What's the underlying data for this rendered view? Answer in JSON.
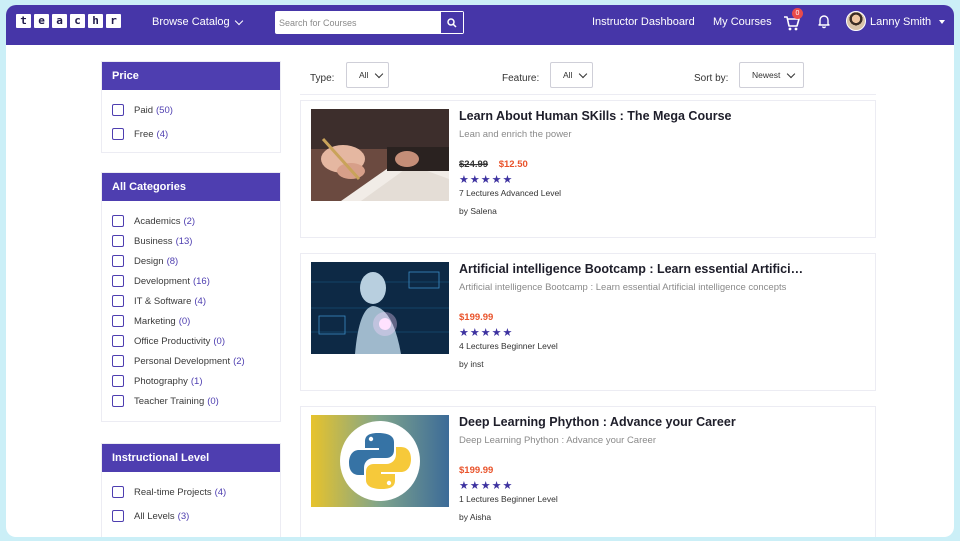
{
  "navbar": {
    "logo_letters": [
      "t",
      "e",
      "a",
      "c",
      "h",
      "r"
    ],
    "browse_label": "Browse Catalog",
    "search_placeholder": "Search for Courses",
    "instructor_dashboard": "Instructor Dashboard",
    "my_courses": "My Courses",
    "cart_count": "0",
    "user_name": "Lanny Smith",
    "accent_color": "#4636a8"
  },
  "sidebar": {
    "price": {
      "title": "Price",
      "items": [
        {
          "label": "Paid",
          "count": "(50)"
        },
        {
          "label": "Free",
          "count": "(4)"
        }
      ]
    },
    "categories": {
      "title": "All Categories",
      "items": [
        {
          "label": "Academics",
          "count": "(2)"
        },
        {
          "label": "Business",
          "count": "(13)"
        },
        {
          "label": "Design",
          "count": "(8)"
        },
        {
          "label": "Development",
          "count": "(16)"
        },
        {
          "label": "IT & Software",
          "count": "(4)"
        },
        {
          "label": "Marketing",
          "count": "(0)"
        },
        {
          "label": "Office Productivity",
          "count": "(0)"
        },
        {
          "label": "Personal Development",
          "count": "(2)"
        },
        {
          "label": "Photography",
          "count": "(1)"
        },
        {
          "label": "Teacher Training",
          "count": "(0)"
        }
      ]
    },
    "level": {
      "title": "Instructional Level",
      "items": [
        {
          "label": "Real-time Projects",
          "count": "(4)"
        },
        {
          "label": "All Levels",
          "count": "(3)"
        }
      ]
    }
  },
  "filters": {
    "type_label": "Type:",
    "type_value": "All",
    "feature_label": "Feature:",
    "feature_value": "All",
    "sort_label": "Sort by:",
    "sort_value": "Newest"
  },
  "courses": [
    {
      "title": "Learn About Human SKills : The Mega Course",
      "subtitle": "Lean and enrich the power",
      "old_price": "$24.99",
      "price": "$12.50",
      "stars": "★★★★★",
      "meta": "7 Lectures  Advanced Level",
      "by": "by Salena"
    },
    {
      "title": "Artificial intelligence Bootcamp : Learn essential Artificial...",
      "subtitle": "Artificial intelligence Bootcamp : Learn essential Artificial intelligence concepts",
      "old_price": "",
      "price": "$199.99",
      "stars": "★★★★★",
      "meta": "4 Lectures  Beginner Level",
      "by": "by inst"
    },
    {
      "title": "Deep Learning Phython : Advance your Career",
      "subtitle": "Deep Learning Phython : Advance your Career",
      "old_price": "",
      "price": "$199.99",
      "stars": "★★★★★",
      "meta": "1 Lectures  Beginner Level",
      "by": "by Aisha"
    }
  ]
}
